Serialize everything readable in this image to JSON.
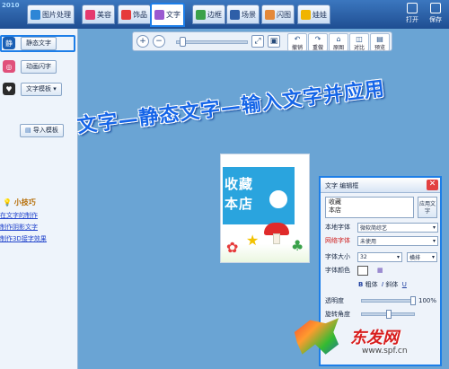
{
  "app": {
    "logo_text": "2010"
  },
  "tabs": [
    {
      "label": "图片处理",
      "color": "#2d86d6"
    },
    {
      "label": "美容",
      "color": "#e53a6f"
    },
    {
      "label": "饰品",
      "color": "#e63b3b"
    },
    {
      "label": "文字",
      "color": "#9b59d0"
    },
    {
      "label": "边框",
      "color": "#3aa14a"
    },
    {
      "label": "场景",
      "color": "#2e5fa8"
    },
    {
      "label": "闪图",
      "color": "#e4893a"
    },
    {
      "label": "娃娃",
      "color": "#f0b400"
    }
  ],
  "toolbar_right": {
    "open_label": "打开",
    "save_label": "保存"
  },
  "sidebar": {
    "static_badge": "静",
    "static_btn": "静态文字",
    "animated_btn": "动画闪字",
    "template_btn": "文字模板",
    "import_btn": "导入模板",
    "tips_title": "小技巧",
    "tips": [
      "在文字的制作",
      "制作阴影文字",
      "制作3D接字效果"
    ]
  },
  "zoom_toolbar": {
    "zoom_in": "+",
    "zoom_out": "−",
    "buttons": [
      "撤销",
      "重做",
      "原图",
      "对比",
      "预览"
    ]
  },
  "banner": "文字—静态文字—输入文字并应用",
  "photo": {
    "lines": [
      "收藏",
      "本店"
    ]
  },
  "text_panel": {
    "title": "文字 编辑框",
    "close": "✕",
    "text_lines": [
      "收藏",
      "本店"
    ],
    "apply_label": "应用文字",
    "local_font_label": "本地字体",
    "local_font_value": "微软简综艺",
    "web_font_label": "网络字体",
    "web_font_value": "未使用",
    "font_size_label": "字体大小",
    "font_size_value": "32",
    "layout_value": "横排",
    "font_color_label": "字体颜色",
    "bold_label": "粗体",
    "italic_label": "斜体",
    "underline_label": "U",
    "opacity_label": "透明度",
    "opacity_value": "100%",
    "opacity": 1.0,
    "rotation_label": "旋转角度"
  },
  "watermark": {
    "main": "东发网",
    "sub": "www.spf.cn"
  }
}
